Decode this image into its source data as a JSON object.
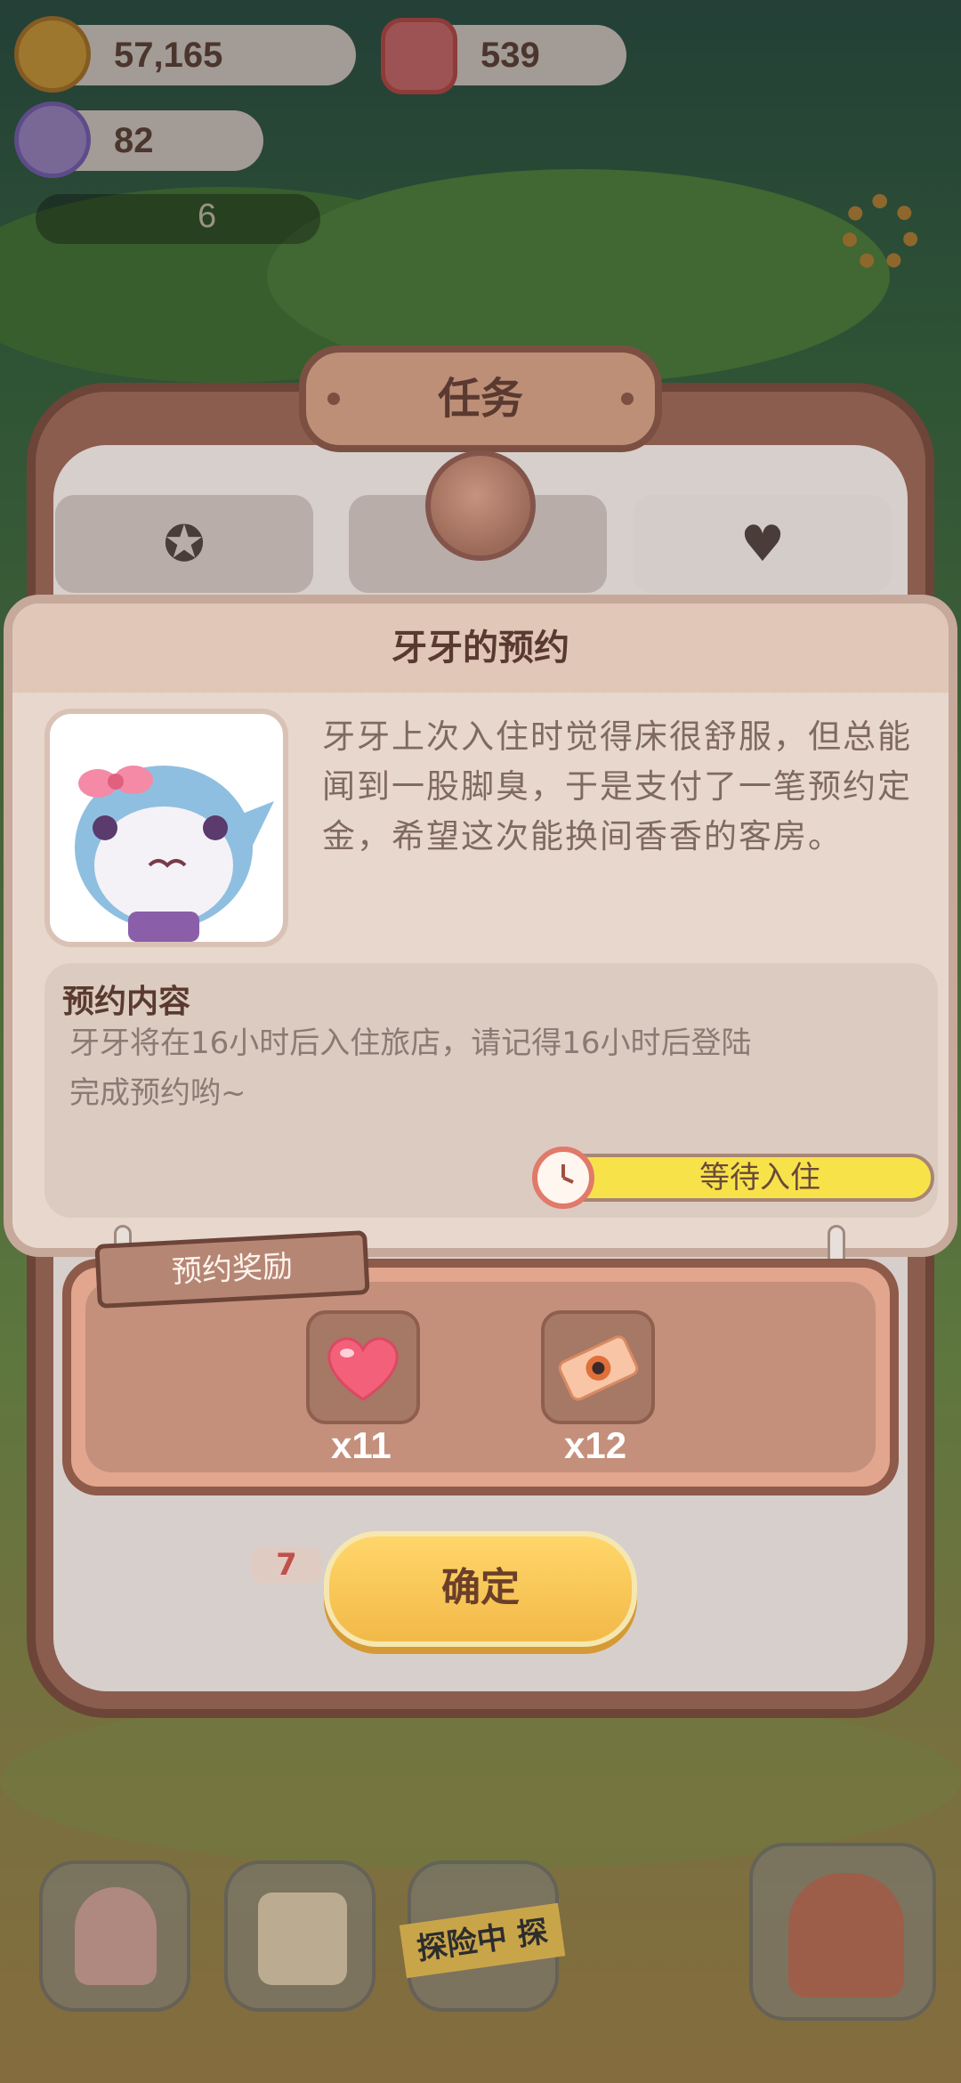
{
  "currencies": {
    "cookies": "57,165",
    "candles": "539",
    "gems": "82",
    "ducks": "6"
  },
  "task_panel": {
    "title": "任务"
  },
  "reservation": {
    "title": "牙牙的预约",
    "description": "牙牙上次入住时觉得床很舒服，但总能闻到一股脚臭，于是支付了一笔预约定金，希望这次能换间香香的客房。",
    "content_label": "预约内容",
    "content_text": "牙牙将在16小时后入住旅店，请记得16小时后登陆完成预约哟~",
    "status_label": "等待入住"
  },
  "rewards": {
    "label": "预约奖励",
    "items": [
      {
        "icon": "heart-icon",
        "count": "x11"
      },
      {
        "icon": "ticket-icon",
        "count": "x12"
      }
    ]
  },
  "confirm_label": "确定",
  "explore_label": "探险中 探",
  "background_badge": "7",
  "colors": {
    "accent_yellow": "#f8e24a",
    "button_gold": "#ffd66a",
    "card_bg": "#e8d7cd",
    "reward_bg": "#e2a58d"
  }
}
